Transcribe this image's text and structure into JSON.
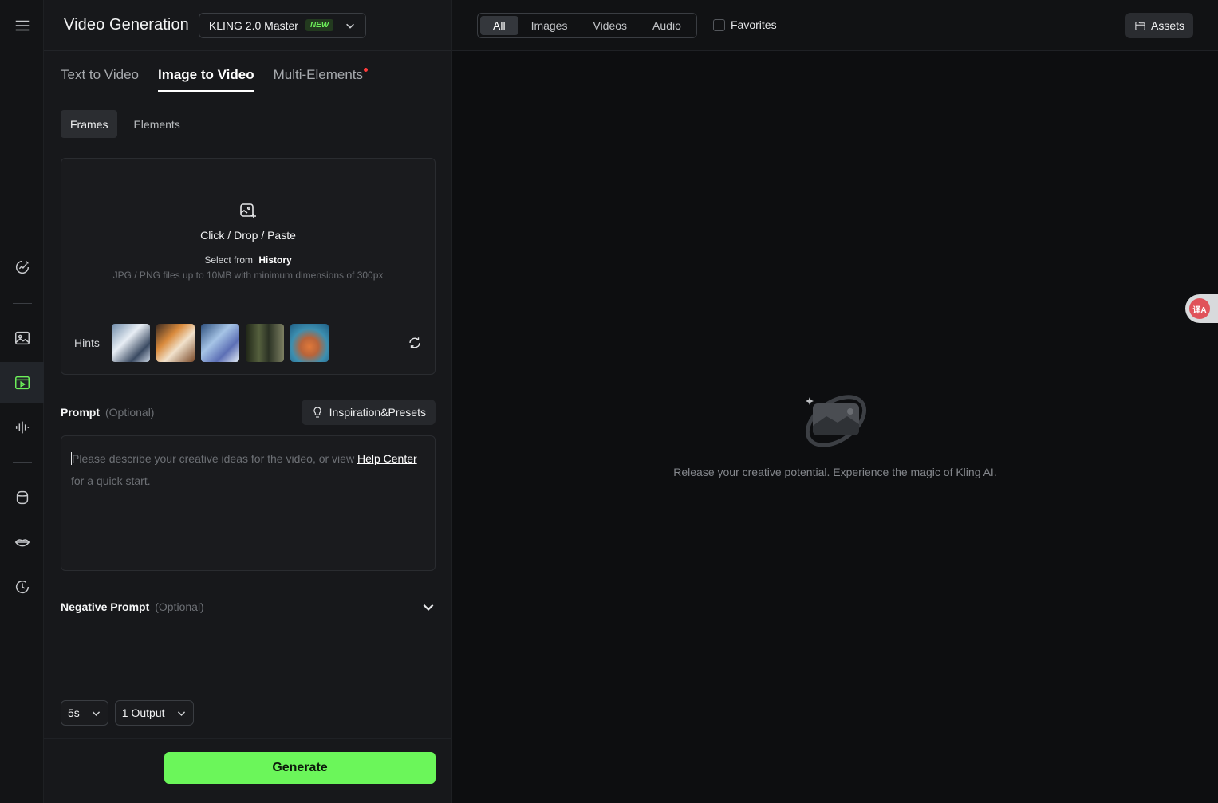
{
  "icons": [
    "menu-icon",
    "edit-image-icon",
    "image-icon",
    "video-icon",
    "audio-icon",
    "avatar-icon",
    "lips-icon",
    "history-icon",
    "chevron-down-icon",
    "upload-icon",
    "refresh-icon",
    "bulb-icon",
    "folder-icon"
  ],
  "panel": {
    "title": "Video Generation",
    "model": {
      "name": "KLING 2.0 Master",
      "badge": "NEW"
    },
    "tabs": [
      {
        "label": "Text to Video"
      },
      {
        "label": "Image to Video"
      },
      {
        "label": "Multi-Elements"
      }
    ],
    "subtabs": [
      {
        "label": "Frames"
      },
      {
        "label": "Elements"
      }
    ],
    "upload": {
      "main_text": "Click / Drop / Paste",
      "select_text": "Select from",
      "history_link": "History",
      "requirements": "JPG / PNG files up to 10MB with minimum dimensions of 300px",
      "hints_label": "Hints"
    },
    "prompt": {
      "label": "Prompt",
      "optional": "(Optional)",
      "presets_button": "Inspiration&Presets",
      "placeholder_before": "Please describe your creative ideas for the video, or view",
      "help_link": "Help Center",
      "placeholder_after": "for a quick start."
    },
    "negative_prompt": {
      "label": "Negative Prompt",
      "optional": "(Optional)"
    },
    "duration": "5s",
    "outputs": "1 Output",
    "generate_button": "Generate"
  },
  "topbar": {
    "filters": [
      "All",
      "Images",
      "Videos",
      "Audio"
    ],
    "favorites_label": "Favorites",
    "assets_button": "Assets"
  },
  "empty_state": {
    "message": "Release your creative potential. Experience the magic of Kling AI."
  },
  "translate_widget": {
    "label": "译A"
  },
  "colors": {
    "accent": "#6bf65a",
    "panel_bg": "#17181b",
    "page_bg": "#0d0e10",
    "notification_dot": "#ff3b3b"
  }
}
